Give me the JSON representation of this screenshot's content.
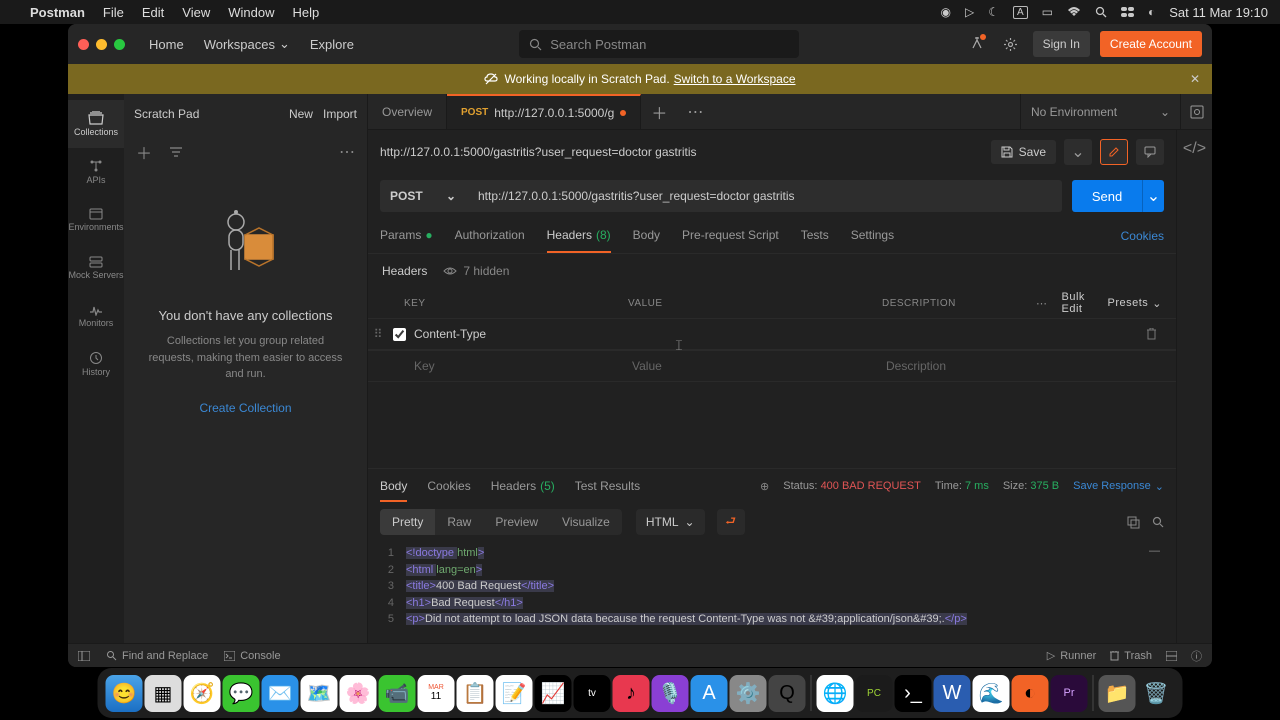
{
  "menubar": {
    "app": "Postman",
    "items": [
      "File",
      "Edit",
      "View",
      "Window",
      "Help"
    ],
    "datetime": "Sat 11 Mar  19:10"
  },
  "topbar": {
    "home": "Home",
    "workspaces": "Workspaces",
    "explore": "Explore",
    "search_placeholder": "Search Postman",
    "signin": "Sign In",
    "create_account": "Create Account"
  },
  "banner": {
    "text": "Working locally in Scratch Pad.",
    "link": "Switch to a Workspace"
  },
  "sidebar": {
    "items": [
      {
        "label": "Collections"
      },
      {
        "label": "APIs"
      },
      {
        "label": "Environments"
      },
      {
        "label": "Mock Servers"
      },
      {
        "label": "Monitors"
      },
      {
        "label": "History"
      }
    ]
  },
  "left_panel": {
    "title": "Scratch Pad",
    "new": "New",
    "import": "Import",
    "empty_title": "You don't have any collections",
    "empty_desc": "Collections let you group related requests, making them easier to access and run.",
    "create": "Create Collection"
  },
  "tabs": {
    "overview": "Overview",
    "active_method": "POST",
    "active_label": "http://127.0.0.1:5000/g",
    "env": "No Environment"
  },
  "request": {
    "title": "http://127.0.0.1:5000/gastritis?user_request=doctor gastritis",
    "save": "Save",
    "method": "POST",
    "url": "http://127.0.0.1:5000/gastritis?user_request=doctor gastritis",
    "send": "Send"
  },
  "req_tabs": {
    "params": "Params",
    "auth": "Authorization",
    "headers": "Headers",
    "headers_count": "(8)",
    "body": "Body",
    "prereq": "Pre-request Script",
    "tests": "Tests",
    "settings": "Settings",
    "cookies": "Cookies"
  },
  "headers_sub": {
    "title": "Headers",
    "hidden": "7 hidden"
  },
  "headers_table": {
    "cols": {
      "key": "KEY",
      "value": "VALUE",
      "desc": "DESCRIPTION"
    },
    "bulk": "Bulk Edit",
    "presets": "Presets",
    "rows": [
      {
        "key": "Content-Type",
        "value": "",
        "desc": ""
      }
    ],
    "placeholders": {
      "key": "Key",
      "value": "Value",
      "desc": "Description"
    }
  },
  "response": {
    "tabs": {
      "body": "Body",
      "cookies": "Cookies",
      "headers": "Headers",
      "headers_count": "(5)",
      "tests": "Test Results"
    },
    "status_label": "Status:",
    "status_code": "400 BAD REQUEST",
    "time_label": "Time:",
    "time_value": "7 ms",
    "size_label": "Size:",
    "size_value": "375 B",
    "save": "Save Response",
    "views": {
      "pretty": "Pretty",
      "raw": "Raw",
      "preview": "Preview",
      "visualize": "Visualize"
    },
    "format": "HTML",
    "code": [
      {
        "n": "1",
        "html": "<span class='tok-doctype'>&lt;!doctype </span><span class='tok-attr'>html</span><span class='tok-doctype'>&gt;</span>"
      },
      {
        "n": "2",
        "html": "<span class='tok-tag'>&lt;html </span><span class='tok-attr'>lang=en</span><span class='tok-tag'>&gt;</span>"
      },
      {
        "n": "3",
        "html": "<span class='tok-tag'>&lt;title&gt;</span><span class='tok-text'>400 Bad Request</span><span class='tok-tag'>&lt;/title&gt;</span>"
      },
      {
        "n": "4",
        "html": "<span class='tok-tag'>&lt;h1&gt;</span><span class='tok-text'>Bad Request</span><span class='tok-tag'>&lt;/h1&gt;</span>"
      },
      {
        "n": "5",
        "html": "<span class='tok-tag'>&lt;p&gt;</span><span class='tok-text'>Did not attempt to load JSON data because the request Content-Type was not &amp;#39;application/json&amp;#39;.</span><span class='tok-tag'>&lt;/p&gt;</span>"
      }
    ]
  },
  "statusbar": {
    "find": "Find and Replace",
    "console": "Console",
    "runner": "Runner",
    "trash": "Trash"
  },
  "dock": {
    "items": [
      "finder",
      "launchpad",
      "safari",
      "messages",
      "mail",
      "maps",
      "photos",
      "facetime",
      "calendar",
      "reminders",
      "notes",
      "stocks",
      "tv",
      "music",
      "podcasts",
      "appstore",
      "settings",
      "quicktime",
      "",
      "chrome",
      "pycharm",
      "terminal",
      "word",
      "edge",
      "postman",
      "premiere",
      "",
      "folder",
      "trash"
    ]
  }
}
